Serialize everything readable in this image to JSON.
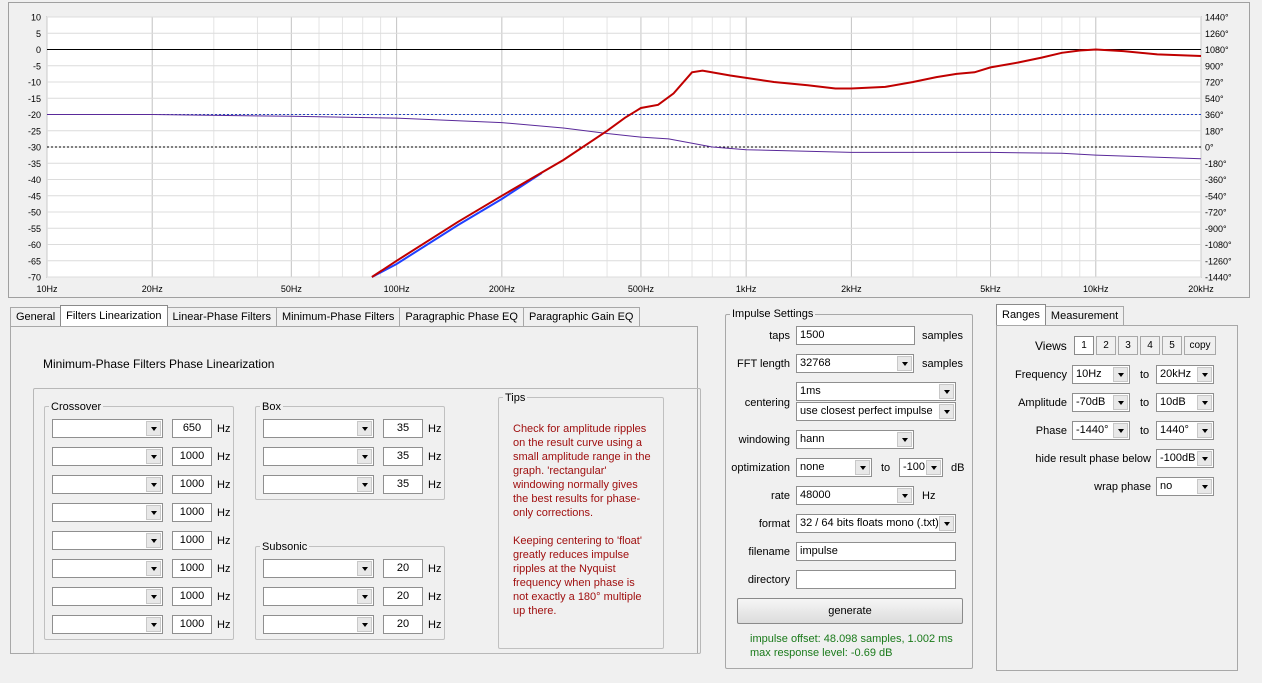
{
  "graph": {
    "amp_ticks": [
      "10",
      "5",
      "0",
      "-5",
      "-10",
      "-15",
      "-20",
      "-25",
      "-30",
      "-35",
      "-40",
      "-45",
      "-50",
      "-55",
      "-60",
      "-65",
      "-70"
    ],
    "phase_ticks": [
      "1440°",
      "1260°",
      "1080°",
      "900°",
      "720°",
      "540°",
      "360°",
      "180°",
      "0°",
      "-180°",
      "-360°",
      "-540°",
      "-720°",
      "-900°",
      "-1080°",
      "-1260°",
      "-1440°"
    ],
    "freq_ticks": [
      {
        "f": 10,
        "label": "10Hz"
      },
      {
        "f": 20,
        "label": "20Hz"
      },
      {
        "f": 50,
        "label": "50Hz"
      },
      {
        "f": 100,
        "label": "100Hz"
      },
      {
        "f": 200,
        "label": "200Hz"
      },
      {
        "f": 500,
        "label": "500Hz"
      },
      {
        "f": 1000,
        "label": "1kHz"
      },
      {
        "f": 2000,
        "label": "2kHz"
      },
      {
        "f": 5000,
        "label": "5kHz"
      },
      {
        "f": 10000,
        "label": "10kHz"
      },
      {
        "f": 20000,
        "label": "20kHz"
      }
    ],
    "amp_range": [
      -70,
      10
    ],
    "phase_range": [
      -1440,
      1440
    ],
    "freq_range": [
      10,
      20000
    ],
    "colors": {
      "amplitude": "#c00000",
      "phase": "#5a2a9a",
      "target": "#2040ff"
    },
    "amplitude_curve": [
      [
        85,
        -70
      ],
      [
        100,
        -65
      ],
      [
        150,
        -53
      ],
      [
        200,
        -45
      ],
      [
        300,
        -34
      ],
      [
        400,
        -25
      ],
      [
        450,
        -21
      ],
      [
        500,
        -18
      ],
      [
        560,
        -17
      ],
      [
        620,
        -13.5
      ],
      [
        700,
        -7
      ],
      [
        750,
        -6.5
      ],
      [
        900,
        -8
      ],
      [
        1200,
        -10
      ],
      [
        1500,
        -11
      ],
      [
        1800,
        -12
      ],
      [
        2000,
        -12
      ],
      [
        2500,
        -11.5
      ],
      [
        3000,
        -10
      ],
      [
        3500,
        -8.5
      ],
      [
        4000,
        -7.5
      ],
      [
        4500,
        -7
      ],
      [
        5000,
        -5.5
      ],
      [
        6000,
        -4
      ],
      [
        7000,
        -2.5
      ],
      [
        8000,
        -1
      ],
      [
        9000,
        -0.3
      ],
      [
        10000,
        0
      ],
      [
        12000,
        -0.5
      ],
      [
        15000,
        -1.5
      ],
      [
        20000,
        -2
      ]
    ],
    "phase_curve": [
      [
        10,
        360
      ],
      [
        20,
        360
      ],
      [
        50,
        340
      ],
      [
        100,
        320
      ],
      [
        200,
        270
      ],
      [
        300,
        210
      ],
      [
        400,
        150
      ],
      [
        500,
        110
      ],
      [
        600,
        90
      ],
      [
        800,
        0
      ],
      [
        1000,
        -30
      ],
      [
        2000,
        -60
      ],
      [
        3000,
        -60
      ],
      [
        5000,
        -60
      ],
      [
        8000,
        -70
      ],
      [
        10000,
        -90
      ],
      [
        20000,
        -130
      ]
    ],
    "target_curve": [
      [
        85,
        -70
      ],
      [
        100,
        -66
      ],
      [
        150,
        -54
      ],
      [
        200,
        -46
      ],
      [
        260,
        -38
      ]
    ],
    "reference_lines": [
      -20,
      -30
    ]
  },
  "tabs": [
    "General",
    "Filters Linearization",
    "Linear-Phase Filters",
    "Minimum-Phase Filters",
    "Paragraphic Phase EQ",
    "Paragraphic Gain EQ"
  ],
  "filters": {
    "title": "Minimum-Phase Filters Phase Linearization",
    "crossover_label": "Crossover",
    "box_label": "Box",
    "subsonic_label": "Subsonic",
    "unit": "Hz",
    "crossover_values": [
      "650",
      "1000",
      "1000",
      "1000",
      "1000",
      "1000",
      "1000",
      "1000"
    ],
    "box_values": [
      "35",
      "35",
      "35"
    ],
    "subsonic_values": [
      "20",
      "20",
      "20"
    ],
    "tips_label": "Tips",
    "tips_text": "Check for amplitude ripples on the result curve using a small amplitude range in the graph. 'rectangular' windowing normally gives the best results for phase-only corrections.\n\nKeeping centering to 'float' greatly reduces impulse ripples at the Nyquist frequency when phase is not exactly a 180° multiple up there."
  },
  "impulse": {
    "section_label": "Impulse Settings",
    "taps_label": "taps",
    "taps_value": "1500",
    "samples_label": "samples",
    "fft_label": "FFT length",
    "fft_value": "32768",
    "fft_samples_label": "samples",
    "centering_label": "centering",
    "centering_value": "1ms",
    "centering_mode": "use closest perfect impulse",
    "windowing_label": "windowing",
    "windowing_value": "hann",
    "optimization_label": "optimization",
    "optimization_value": "none",
    "opt_to_label": "to",
    "opt_db_value": "-100",
    "opt_db_unit": "dB",
    "rate_label": "rate",
    "rate_value": "48000",
    "rate_unit": "Hz",
    "format_label": "format",
    "format_value": "32 / 64 bits floats mono (.txt)",
    "filename_label": "filename",
    "filename_value": "impulse",
    "directory_label": "directory",
    "directory_value": "",
    "generate_label": "generate",
    "status_offset": "impulse offset: 48.098 samples, 1.002 ms",
    "status_level": "max response level: -0.69 dB"
  },
  "ranges": {
    "tabs": [
      "Ranges",
      "Measurement"
    ],
    "views_label": "Views",
    "view_buttons": [
      "1",
      "2",
      "3",
      "4",
      "5"
    ],
    "copy_label": "copy",
    "to_label": "to",
    "frequency_label": "Frequency",
    "freq_from": "10Hz",
    "freq_to": "20kHz",
    "amplitude_label": "Amplitude",
    "amp_from": "-70dB",
    "amp_to": "10dB",
    "phase_label": "Phase",
    "phase_from": "-1440°",
    "phase_to": "1440°",
    "hide_label": "hide result phase below",
    "hide_value": "-100dB",
    "wrap_label": "wrap phase",
    "wrap_value": "no"
  }
}
